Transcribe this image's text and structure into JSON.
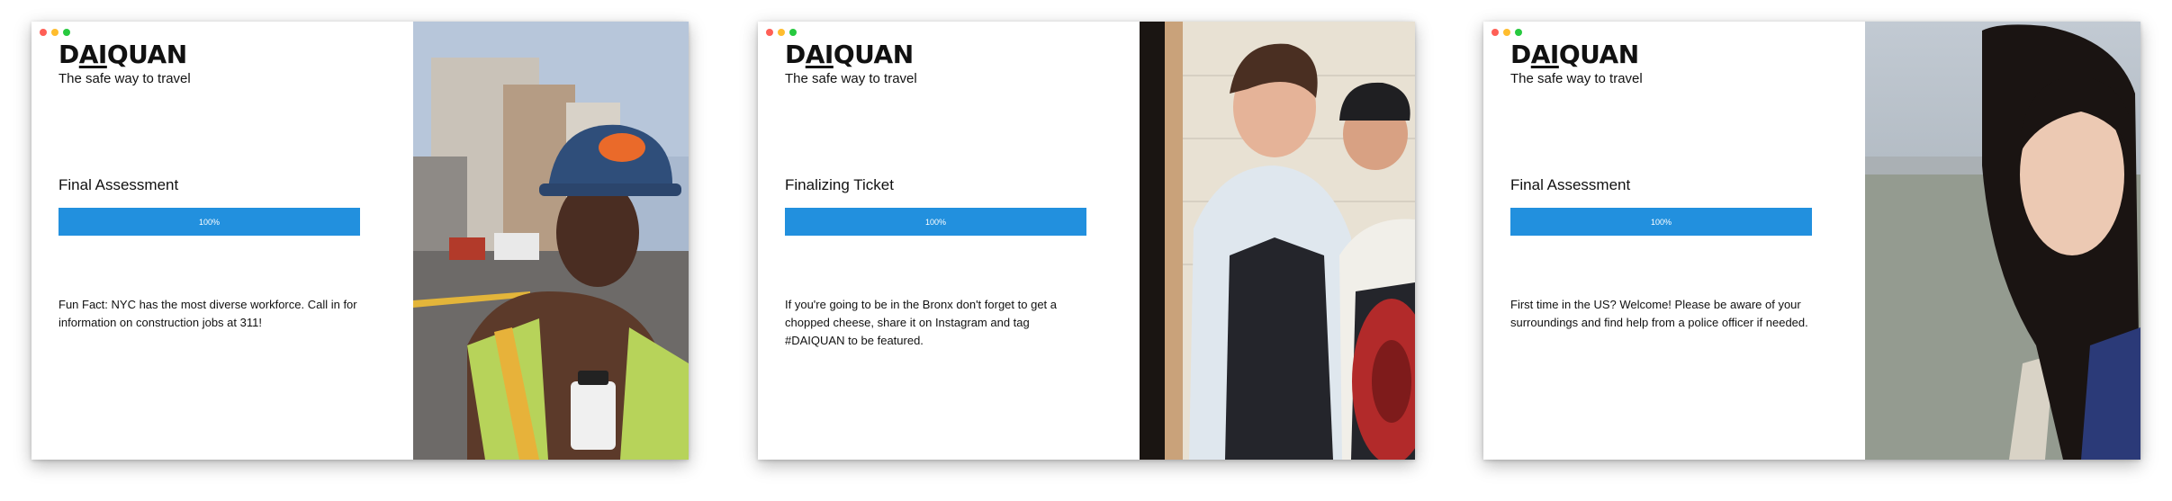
{
  "brand": {
    "logo_prefix": "D",
    "logo_underlined": "AI",
    "logo_suffix": "QUAN",
    "tagline": "The safe way to travel"
  },
  "screens": [
    {
      "stage_title": "Final Assessment",
      "progress": 1.0,
      "progress_label": "100%",
      "fact": "Fun Fact: NYC has the most diverse workforce. Call in for information on construction jobs at 311!",
      "photo_icon": "construction-worker-photo"
    },
    {
      "stage_title": "Finalizing Ticket",
      "progress": 1.0,
      "progress_label": "100%",
      "fact": "If you're going to be in the Bronx don't forget to get a chopped cheese, share it on Instagram and tag #DAIQUAN to be featured.",
      "photo_icon": "chefs-photo"
    },
    {
      "stage_title": "Final Assessment",
      "progress": 1.0,
      "progress_label": "100%",
      "fact": "First time in the US? Welcome! Please be aware of your surroundings and find help from a police officer if needed.",
      "photo_icon": "traveler-photo"
    }
  ],
  "colors": {
    "accent": "#2290de",
    "text": "#111111",
    "window_red": "#ff5f56",
    "window_yellow": "#ffbd2e",
    "window_green": "#27c93f"
  }
}
